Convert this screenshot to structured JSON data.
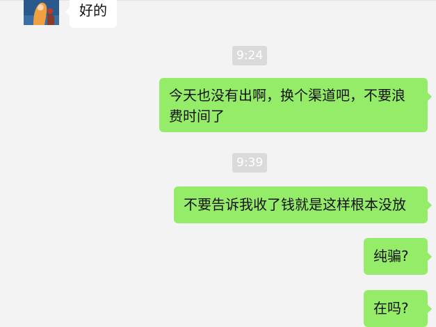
{
  "chat": {
    "messages": [
      {
        "side": "left",
        "text": "好的"
      },
      {
        "type": "time",
        "text": "9:24"
      },
      {
        "side": "right",
        "text": "今天也没有出啊，换个渠道吧，不要浪费时间了"
      },
      {
        "type": "time",
        "text": "9:39"
      },
      {
        "side": "right",
        "text": "不要告诉我收了钱就是这样根本没放"
      },
      {
        "side": "right",
        "text": "纯骗?"
      },
      {
        "side": "right",
        "text": "在吗?"
      }
    ]
  },
  "colors": {
    "background": "#f3f3f3",
    "incoming_bubble": "#ffffff",
    "outgoing_bubble": "#95ec69",
    "timestamp_bg": "#dadada",
    "timestamp_text": "#ffffff"
  }
}
